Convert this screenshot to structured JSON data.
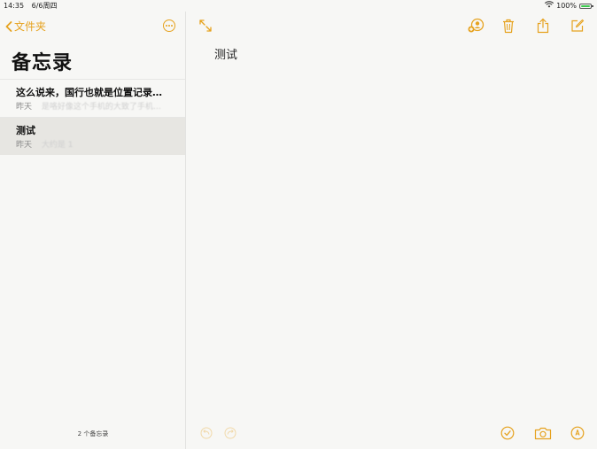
{
  "status_bar": {
    "time": "14:35",
    "date": "6/6周四",
    "battery": "100%",
    "battery_level": 1.0
  },
  "sidebar": {
    "back_label": "文件夹",
    "title": "备忘录",
    "notes": [
      {
        "title": "这么说来，国行也就是位置记录…",
        "date": "昨天",
        "preview": "是咯好像这个手机的大致了手机…"
      },
      {
        "title": "测试",
        "date": "昨天",
        "preview": "大约是 1"
      }
    ],
    "count": "2 个备忘录"
  },
  "editor": {
    "heading": "测试"
  },
  "colors": {
    "accent": "#e6a21e",
    "selected_row": "#e7e6e2",
    "background": "#f7f7f5"
  },
  "icons": {
    "top": [
      "expand-icon",
      "add-people-icon",
      "trash-icon",
      "share-icon",
      "compose-icon"
    ],
    "bottom": [
      "undo-icon",
      "redo-icon",
      "checklist-icon",
      "camera-icon",
      "markup-icon"
    ]
  }
}
